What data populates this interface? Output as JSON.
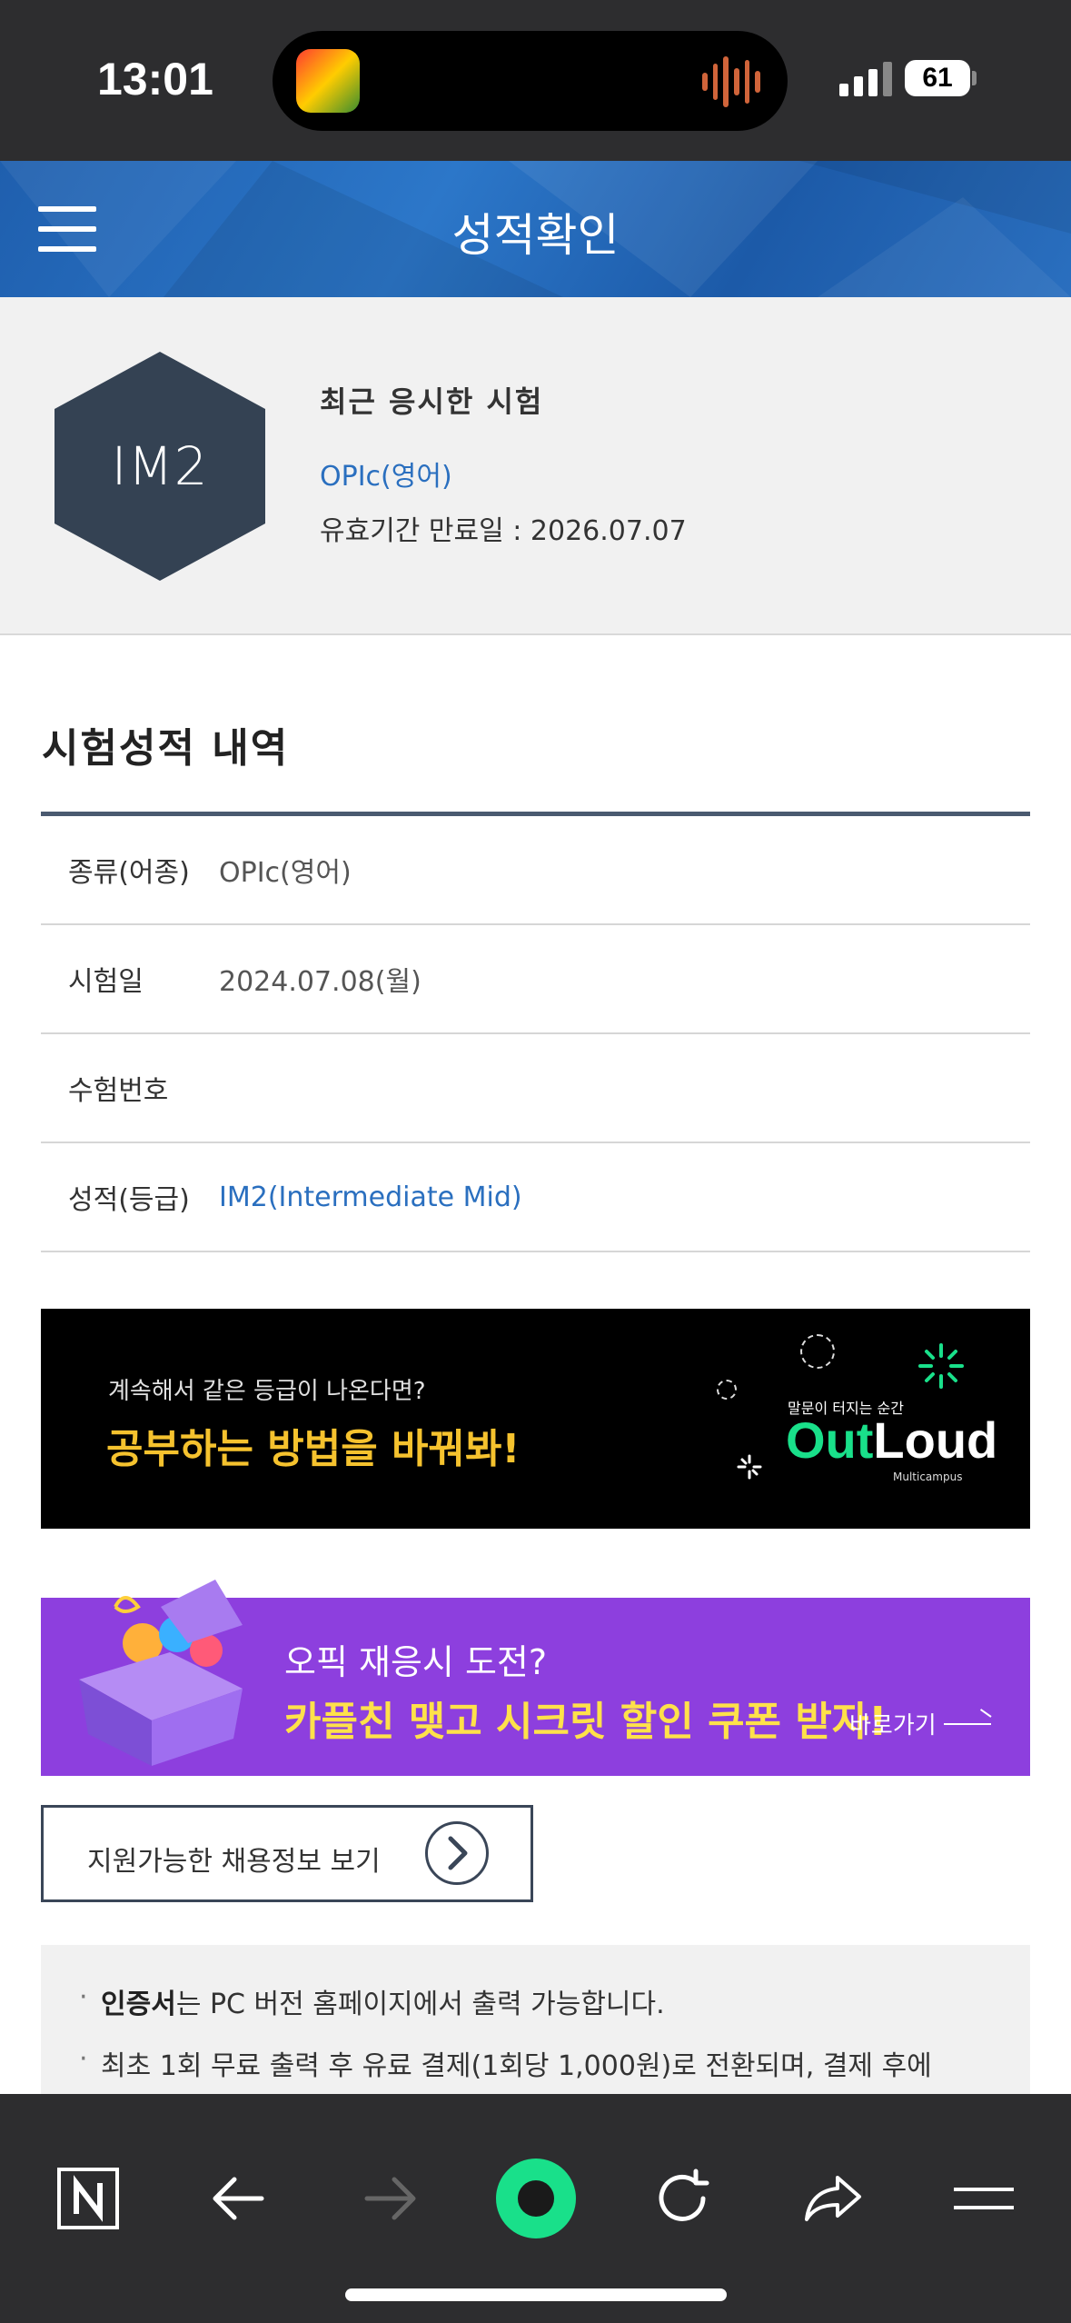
{
  "status_bar": {
    "time": "13:01",
    "battery": "61"
  },
  "header": {
    "title": "성적확인"
  },
  "recent": {
    "badge": "IM2",
    "title": "최근 응시한 시험",
    "exam": "OPIc(영어)",
    "expiry": "유효기간 만료일 : 2026.07.07"
  },
  "section": {
    "title": "시험성적 내역"
  },
  "table": {
    "rows": [
      {
        "label": "종류(어종)",
        "value": "OPIc(영어)"
      },
      {
        "label": "시험일",
        "value": "2024.07.08(월)"
      },
      {
        "label": "수험번호",
        "value": ""
      },
      {
        "label": "성적(등급)",
        "value": "IM2(Intermediate Mid)"
      }
    ]
  },
  "banner1": {
    "subtitle": "계속해서 같은 등급이 나온다면?",
    "headline": "공부하는 방법을 바꿔봐!",
    "tagline": "말문이 터지는 순간",
    "logo_a": "Out",
    "logo_b": "Loud",
    "logo_sub": "Multicampus"
  },
  "banner2": {
    "question": "오픽 재응시 도전?",
    "headline": "카플친 맺고 시크릿 할인 쿠폰 받자!",
    "link": "바로가기"
  },
  "jobs": {
    "label": "지원가능한 채용정보 보기"
  },
  "notice": {
    "line1_bold": "인증서",
    "line1_rest": "는 PC 버전 홈페이지에서 출력 가능합니다.",
    "line2": "최초 1회 무료 출력 후 유료 결제(1회당 1,000원)로 전환되며, 결제 후에"
  },
  "colors": {
    "header_blue": "#2a6fbf",
    "badge_navy": "#344253",
    "banner_yellow": "#f5c22e",
    "banner_purple": "#8d3fde",
    "accent_green": "#19e08a"
  }
}
